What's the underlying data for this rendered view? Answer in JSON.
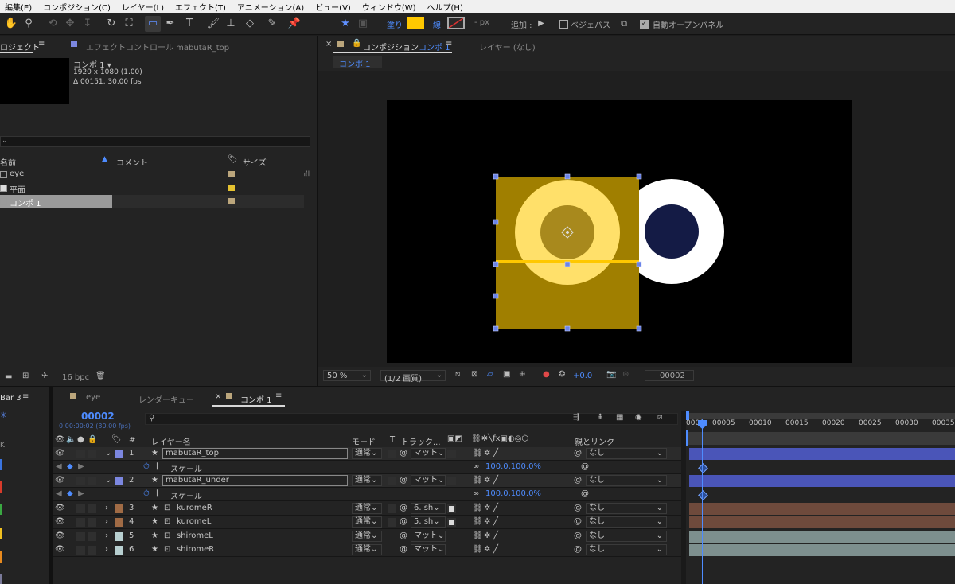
{
  "menu": [
    "編集(E)",
    "コンポジション(C)",
    "レイヤー(L)",
    "エフェクト(T)",
    "アニメーション(A)",
    "ビュー(V)",
    "ウィンドウ(W)",
    "ヘルプ(H)"
  ],
  "toolbar": {
    "fill_label": "塗り",
    "stroke_label": "線",
    "stroke_px": "- px",
    "add_label": "追加 :",
    "bezier_label": "ベジェパス",
    "auto_open_label": "自動オープンパネル",
    "fill_color": "#ffc800"
  },
  "project_panel": {
    "tab_project": "ロジェクト",
    "tab_effect": "エフェクトコントロール mabutaR_top",
    "comp_name": "コンポ 1 ▾",
    "comp_size": "1920 x 1080 (1.00)",
    "comp_duration": "Δ 00151, 30.00 fps",
    "col_name": "名前",
    "col_comment": "コメント",
    "col_size": "サイズ",
    "items": [
      {
        "name": "eye",
        "color": "#bba67c"
      },
      {
        "name": "平面",
        "color": "#e5c230"
      },
      {
        "name": "コンポ 1",
        "color": "#bba67c"
      }
    ],
    "bpc": "16 bpc"
  },
  "composition_panel": {
    "tab_label": "コンポジション",
    "tab_comp": "コンポ 1",
    "tab_layer": "レイヤー (なし)",
    "breadcrumb": "コンポ 1",
    "zoom": "50 %",
    "quality": "(1/2 画質)",
    "exposure": "+0.0",
    "timecode": "00002"
  },
  "timeline": {
    "left_tab": "Bar 3",
    "tabs": [
      "eye",
      "レンダーキュー",
      "コンポ 1"
    ],
    "timecode": "00002",
    "timecode_sub": "0:00:00:02 (30.00 fps)",
    "col_layer_name": "レイヤー名",
    "col_mode": "モード",
    "col_t": "T",
    "col_track": "トラック...",
    "col_parent": "親とリンク",
    "ruler": [
      "0000",
      "00005",
      "00010",
      "00015",
      "00020",
      "00025",
      "00030",
      "00035"
    ],
    "scale_label": "スケール",
    "scale_value": "100.0,100.0%",
    "layers": [
      {
        "num": "1",
        "name": "mabutaR_top",
        "color": "#7c87e0",
        "mode": "通常",
        "track": "マット",
        "parent": "なし",
        "bar_color": "#4a55b8",
        "expanded": true
      },
      {
        "num": "2",
        "name": "mabutaR_under",
        "color": "#7c87e0",
        "mode": "通常",
        "track": "マット",
        "parent": "なし",
        "bar_color": "#4a55b8",
        "expanded": true
      },
      {
        "num": "3",
        "name": "kuromeR",
        "color": "#a06b45",
        "mode": "通常",
        "track": "6. sh",
        "parent": "なし",
        "bar_color": "#6e4a3c",
        "expanded": false
      },
      {
        "num": "4",
        "name": "kuromeL",
        "color": "#a06b45",
        "mode": "通常",
        "track": "5. sh",
        "parent": "なし",
        "bar_color": "#6e4a3c",
        "expanded": false
      },
      {
        "num": "5",
        "name": "shiromeL",
        "color": "#b7cfd0",
        "mode": "通常",
        "track": "マット",
        "parent": "なし",
        "bar_color": "#7d8f8e",
        "expanded": false
      },
      {
        "num": "6",
        "name": "shiromeR",
        "color": "#b7cfd0",
        "mode": "通常",
        "track": "マット",
        "parent": "なし",
        "bar_color": "#7d8f8e",
        "expanded": false
      }
    ]
  }
}
